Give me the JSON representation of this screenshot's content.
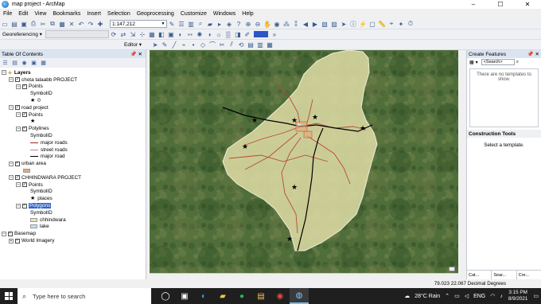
{
  "window": {
    "title": "map project - ArcMap",
    "minimize": "–",
    "maximize": "☐",
    "close": "✕"
  },
  "menu": [
    "File",
    "Edit",
    "View",
    "Bookmarks",
    "Insert",
    "Selection",
    "Geoprocessing",
    "Customize",
    "Windows",
    "Help"
  ],
  "toolbar": {
    "scale": "1:147,212",
    "georeferencing_label": "Georeferencing ▾",
    "editor_label": "Editor ▾"
  },
  "toc": {
    "title": "Table Of Contents",
    "pin": "📌 ✕",
    "rows": [
      {
        "label": "Layers",
        "indent": 0,
        "kind": "group",
        "bold": true
      },
      {
        "label": "chota talaabb PROJECT",
        "indent": 1,
        "kind": "group"
      },
      {
        "label": "Points",
        "indent": 2,
        "kind": "layer"
      },
      {
        "label": "SymbolID",
        "indent": 4,
        "kind": "text"
      },
      {
        "label": "0",
        "indent": 4,
        "kind": "star"
      },
      {
        "label": "road project",
        "indent": 1,
        "kind": "group"
      },
      {
        "label": "Points",
        "indent": 2,
        "kind": "layer"
      },
      {
        "label": "",
        "indent": 4,
        "kind": "star"
      },
      {
        "label": "Polylines",
        "indent": 2,
        "kind": "layer"
      },
      {
        "label": "SymbolID",
        "indent": 4,
        "kind": "text"
      },
      {
        "label": "major roads",
        "indent": 4,
        "kind": "line",
        "color": "#9a2a2a"
      },
      {
        "label": "street roads",
        "indent": 4,
        "kind": "line",
        "color": "#d97a7a"
      },
      {
        "label": "major road",
        "indent": 4,
        "kind": "line",
        "color": "#000000"
      },
      {
        "label": "urban area",
        "indent": 1,
        "kind": "group"
      },
      {
        "label": "",
        "indent": 3,
        "kind": "box",
        "color": "#e7a77a"
      },
      {
        "label": "CHHINDWARA PROJECT",
        "indent": 1,
        "kind": "group"
      },
      {
        "label": "Points",
        "indent": 2,
        "kind": "layer"
      },
      {
        "label": "SymbolID",
        "indent": 4,
        "kind": "text"
      },
      {
        "label": "places",
        "indent": 4,
        "kind": "star"
      },
      {
        "label": "Polygons",
        "indent": 2,
        "kind": "layer",
        "selected": true
      },
      {
        "label": "SymbolID",
        "indent": 4,
        "kind": "text"
      },
      {
        "label": "chhindwara",
        "indent": 4,
        "kind": "box",
        "color": "#e8e4b9"
      },
      {
        "label": "lake",
        "indent": 4,
        "kind": "box",
        "color": "#bfe3f3"
      },
      {
        "label": "Basemap",
        "indent": 0,
        "kind": "group"
      },
      {
        "label": "World Imagery",
        "indent": 1,
        "kind": "layer",
        "collapsed": true
      }
    ]
  },
  "create_features": {
    "title": "Create Features",
    "pin": "📌 ✕",
    "search_placeholder": "<Search>",
    "message": "There are no templates to show."
  },
  "construction_tools": {
    "title": "Construction Tools",
    "message": "Select a template."
  },
  "right_tabs": [
    "Cat...",
    "Sear...",
    "Cre..."
  ],
  "status": {
    "coords": "79.023  22.067 Decimal Degrees"
  },
  "taskbar": {
    "search_placeholder": "Type here to search",
    "weather": "28°C  Rain",
    "lang": "ENG",
    "time": "3:15 PM",
    "date": "8/9/2021"
  },
  "colors": {
    "polygon_fill": "#dcd9a3",
    "polygon_stroke": "#eeecd6",
    "major_road": "#000000",
    "street_road": "#b54a3a",
    "imagery_base": "#4f6e3a"
  }
}
